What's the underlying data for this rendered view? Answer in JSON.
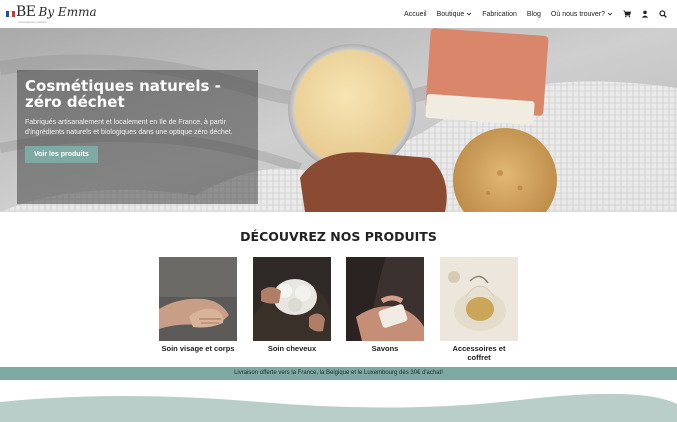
{
  "brand": {
    "logo_text": "BE",
    "logo_script": "By Emma",
    "logo_sub": "cosmétiques naturels",
    "flag_colors": [
      "#1f4fa0",
      "#ffffff",
      "#d9332b"
    ]
  },
  "nav": {
    "items": [
      {
        "label": "Accueil",
        "dropdown": false
      },
      {
        "label": "Boutique",
        "dropdown": true
      },
      {
        "label": "Fabrication",
        "dropdown": false
      },
      {
        "label": "Blog",
        "dropdown": false
      },
      {
        "label": "Où nous trouver?",
        "dropdown": true
      }
    ],
    "icons": [
      "cart-icon",
      "user-icon",
      "search-icon"
    ]
  },
  "hero": {
    "title": "Cosmétiques naturels - zéro déchet",
    "text": "Fabriqués artisanalement et localement en Ile de France, à partir d'ingrédients naturels et biologiques dans une optique zéro déchet.",
    "button": "Voir les produits"
  },
  "section": {
    "title": "DÉCOUVREZ NOS PRODUITS"
  },
  "products": [
    {
      "name": "Soin visage et corps"
    },
    {
      "name": "Soin cheveux"
    },
    {
      "name": "Savons"
    },
    {
      "name": "Accessoires et coffret"
    }
  ],
  "banner": {
    "text": "Livraison offerte vers la France, la Belgique et le Luxembourg dès 30€ d'achat!"
  },
  "colors": {
    "accent": "#7faaa3",
    "footer": "#b9cdc9"
  }
}
